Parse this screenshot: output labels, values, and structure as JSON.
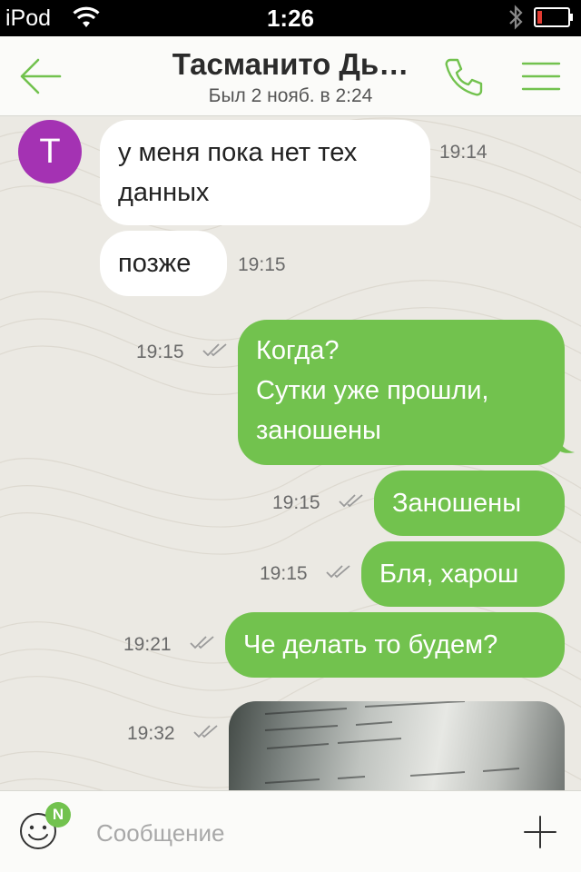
{
  "status_bar": {
    "carrier": "iPod",
    "time": "1:26"
  },
  "header": {
    "contact_name": "Тасманито Дь…",
    "last_seen": "Был 2 нояб. в 2:24"
  },
  "avatar": {
    "letter": "T",
    "color": "#a432b3"
  },
  "messages": [
    {
      "direction": "in",
      "text": "у меня пока нет тех данных",
      "time": "19:14"
    },
    {
      "direction": "in",
      "text": "позже",
      "time": "19:15"
    },
    {
      "direction": "out",
      "lines": [
        "Когда?",
        "Сутки уже прошли,",
        "заношены"
      ],
      "time": "19:15"
    },
    {
      "direction": "out",
      "text": "Заношены",
      "time": "19:15"
    },
    {
      "direction": "out",
      "text": "Бля, харош",
      "time": "19:15"
    },
    {
      "direction": "out",
      "text": "Че делать то будем?",
      "time": "19:21"
    },
    {
      "direction": "out",
      "type": "photo",
      "time": "19:32"
    }
  ],
  "composer": {
    "placeholder": "Сообщение",
    "emoji_badge": "N"
  },
  "colors": {
    "accent": "#72c24e",
    "outgoing_bubble": "#72c24e",
    "incoming_bubble": "#ffffff",
    "chat_background": "#ebe9e3"
  }
}
